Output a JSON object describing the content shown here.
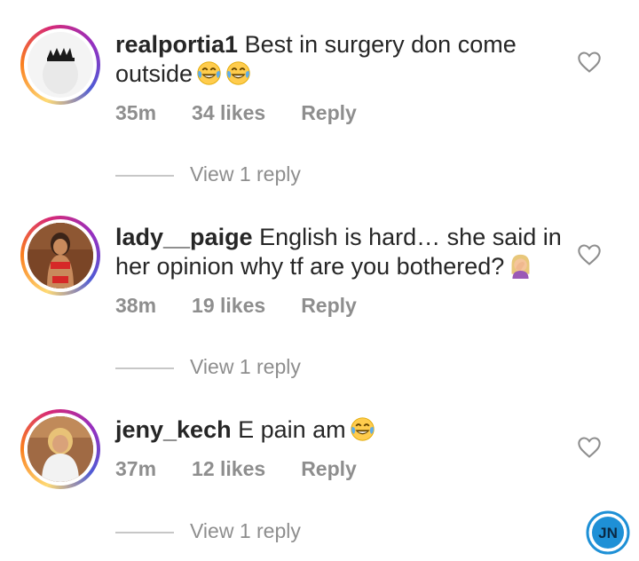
{
  "comments": [
    {
      "username": "realportia1",
      "text": " Best in surgery don come outside",
      "time": "35m",
      "likes": "34 likes",
      "reply": "Reply",
      "view_replies": "View 1 reply",
      "emojis": [
        "laughing-tears-emoji",
        "laughing-tears-emoji"
      ]
    },
    {
      "username": "lady__paige",
      "text": " English is hard… she said in her opinion why tf are you bothered?",
      "time": "38m",
      "likes": "19 likes",
      "reply": "Reply",
      "view_replies": "View 1 reply",
      "emojis": [
        "woman-facepalming-emoji"
      ]
    },
    {
      "username": "jeny_kech",
      "text": " E pain am",
      "time": "37m",
      "likes": "12 likes",
      "reply": "Reply",
      "view_replies": "View 1 reply",
      "emojis": [
        "laughing-tears-emoji"
      ]
    }
  ],
  "icons": {
    "like": "heart-outline-icon",
    "watermark": "jn-logo"
  },
  "colors": {
    "text": "#262626",
    "meta": "#8e8e8e",
    "divider": "#c7c7c7",
    "watermark": "#1e90d6"
  }
}
